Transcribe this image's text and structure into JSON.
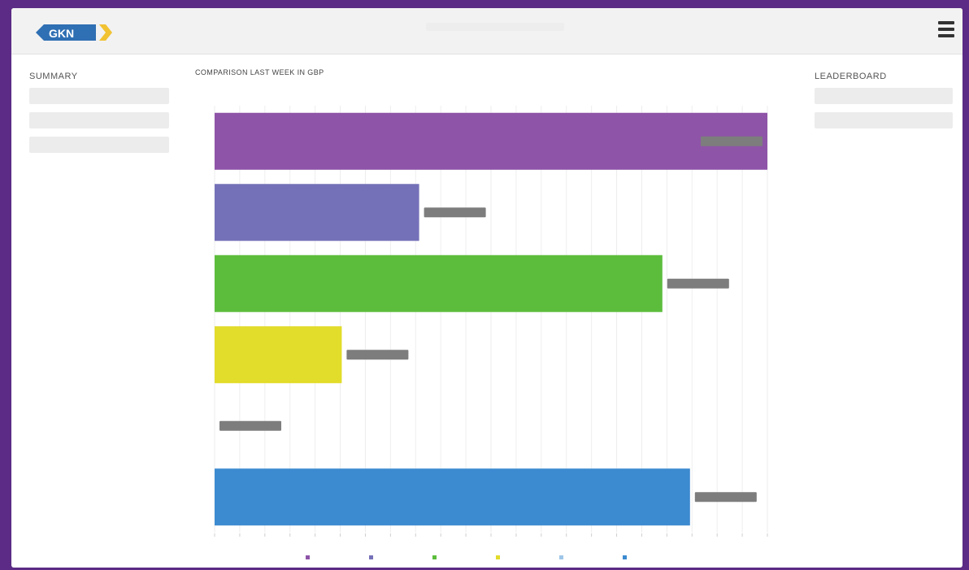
{
  "header": {
    "logo_text": "GKN",
    "menu_icon": "hamburger-icon"
  },
  "summary": {
    "title": "SUMMARY",
    "fields": [
      {
        "label": "",
        "value": ""
      },
      {
        "label": "",
        "value": ""
      },
      {
        "label": "",
        "value": ""
      }
    ]
  },
  "leaderboard": {
    "title": "LEADERBOARD",
    "fields": [
      {
        "label": "",
        "value": ""
      },
      {
        "label": "",
        "value": ""
      }
    ]
  },
  "colors": {
    "page_background": "#5b2b85",
    "accent_blue": "#3a8fd0",
    "logo_blue": "#2f6fb3",
    "logo_yellow": "#f1c232"
  },
  "chart_data": {
    "type": "bar",
    "orientation": "horizontal",
    "title": "COMPARISON LAST WEEK IN GBP",
    "subtitle": "",
    "xlabel": "",
    "ylabel": "",
    "xlim": [
      0,
      1
    ],
    "grid": true,
    "legend_position": "bottom",
    "bars": [
      {
        "value": 1.0,
        "color": "#8e54a8",
        "label": ""
      },
      {
        "value": 0.37,
        "color": "#7571b8",
        "label": ""
      },
      {
        "value": 0.81,
        "color": "#5cbd3c",
        "label": ""
      },
      {
        "value": 0.23,
        "color": "#e2dc2a",
        "label": ""
      },
      {
        "value": 0.0,
        "color": "#9fc6e8",
        "label": ""
      },
      {
        "value": 0.86,
        "color": "#3c8ad0",
        "label": ""
      }
    ],
    "legend": [
      {
        "name": "",
        "color": "#8e54a8"
      },
      {
        "name": "",
        "color": "#7571b8"
      },
      {
        "name": "",
        "color": "#5cbd3c"
      },
      {
        "name": "",
        "color": "#e2dc2a"
      },
      {
        "name": "",
        "color": "#9fc6e8"
      },
      {
        "name": "",
        "color": "#3c8ad0"
      }
    ],
    "tick_count": 22
  }
}
